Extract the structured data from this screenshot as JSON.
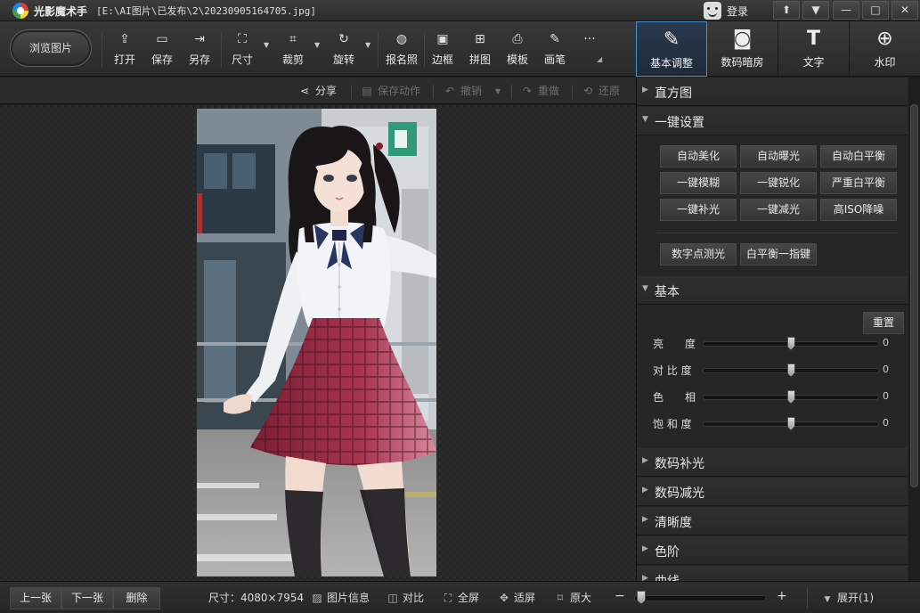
{
  "title_bar": {
    "app_name": "光影魔术手",
    "file_path": "[E:\\AI图片\\已发布\\2\\20230905164705.jpg]",
    "login_label": "登录",
    "icons": [
      "app-logo-icon",
      "face-icon",
      "pin-icon",
      "menu-icon",
      "minimize-icon",
      "maximize-icon",
      "close-icon"
    ],
    "window_buttons": [
      "⬆",
      "▼",
      "—",
      "□",
      "✕"
    ]
  },
  "toolbar": {
    "browse_label": "浏览图片",
    "tools": [
      {
        "label": "打开",
        "icon": "open-icon",
        "glyph": "⇪"
      },
      {
        "label": "保存",
        "icon": "save-icon",
        "glyph": "▭"
      },
      {
        "label": "另存",
        "icon": "save-as-icon",
        "glyph": "⇥"
      },
      {
        "label": "尺寸",
        "icon": "resize-icon",
        "glyph": "⛶"
      },
      {
        "label": "裁剪",
        "icon": "crop-icon",
        "glyph": "⌗"
      },
      {
        "label": "旋转",
        "icon": "rotate-icon",
        "glyph": "↻"
      },
      {
        "label": "报名照",
        "icon": "id-photo-icon",
        "glyph": "◍"
      },
      {
        "label": "边框",
        "icon": "border-icon",
        "glyph": "▣"
      },
      {
        "label": "拼图",
        "icon": "collage-icon",
        "glyph": "⊞"
      },
      {
        "label": "模板",
        "icon": "template-icon",
        "glyph": "⎙"
      },
      {
        "label": "画笔",
        "icon": "brush-icon",
        "glyph": "✎"
      },
      {
        "label": "",
        "icon": "more-icon",
        "glyph": "···"
      }
    ]
  },
  "tabs": [
    {
      "label": "基本调整",
      "icon": "basic-adjust-icon",
      "glyph": "✎",
      "active": true
    },
    {
      "label": "数码暗房",
      "icon": "darkroom-icon",
      "glyph": "◙",
      "active": false
    },
    {
      "label": "文字",
      "icon": "text-icon",
      "glyph": "T",
      "active": false
    },
    {
      "label": "水印",
      "icon": "watermark-icon",
      "glyph": "⊕",
      "active": false
    }
  ],
  "action_bar": [
    {
      "label": "分享",
      "icon": "share-icon",
      "glyph": "⋖",
      "enabled": true
    },
    {
      "label": "保存动作",
      "icon": "save-action-icon",
      "glyph": "▤",
      "enabled": false
    },
    {
      "label": "撤销",
      "icon": "undo-icon",
      "glyph": "↶",
      "enabled": false
    },
    {
      "label": "重做",
      "icon": "redo-icon",
      "glyph": "↷",
      "enabled": false
    },
    {
      "label": "还原",
      "icon": "restore-icon",
      "glyph": "⟲",
      "enabled": false
    }
  ],
  "panel": {
    "histogram_title": "直方图",
    "one_click_title": "一键设置",
    "one_click_buttons": [
      [
        "自动美化",
        "自动曝光",
        "自动白平衡"
      ],
      [
        "一键模糊",
        "一键锐化",
        "严重白平衡"
      ],
      [
        "一键补光",
        "一键减光",
        "高ISO降噪"
      ]
    ],
    "extra_buttons": [
      "数字点测光",
      "白平衡一指键"
    ],
    "basic_title": "基本",
    "reset_label": "重置",
    "sliders": [
      {
        "label": "亮　　度",
        "value": "0",
        "position": 0.5
      },
      {
        "label": "对 比 度",
        "value": "0",
        "position": 0.5
      },
      {
        "label": "色　　相",
        "value": "0",
        "position": 0.5
      },
      {
        "label": "饱 和 度",
        "value": "0",
        "position": 0.5
      }
    ],
    "collapsed_sections": [
      "数码补光",
      "数码减光",
      "清晰度",
      "色阶",
      "曲线"
    ]
  },
  "status_bar": {
    "prev_label": "上一张",
    "next_label": "下一张",
    "delete_label": "删除",
    "size_text": "尺寸：4080×7954",
    "items": [
      {
        "label": "图片信息",
        "icon": "image-info-icon",
        "glyph": "▨"
      },
      {
        "label": "对比",
        "icon": "compare-icon",
        "glyph": "◫"
      },
      {
        "label": "全屏",
        "icon": "fullscreen-icon",
        "glyph": "⛶"
      },
      {
        "label": "适屏",
        "icon": "fit-screen-icon",
        "glyph": "✥"
      },
      {
        "label": "原大",
        "icon": "original-size-icon",
        "glyph": "⌑"
      }
    ],
    "zoom_minus": "−",
    "zoom_plus": "+",
    "zoom_position": 0.02,
    "expand_label": "展开(1)"
  },
  "colors": {
    "accent": "#4a90d9",
    "background": "#1e1e1e",
    "panel": "#262626",
    "skirt": "#9e2a44"
  }
}
